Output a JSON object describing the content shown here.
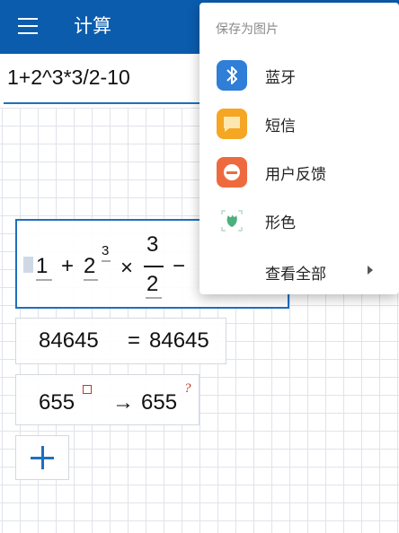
{
  "app_bar": {
    "title": "计算",
    "menu_icon": "hamburger-menu-icon",
    "color": "#0b5cad"
  },
  "input": {
    "value": "1+2^3*3/2-10"
  },
  "formula": {
    "t1": "1",
    "t2": "+",
    "t3": "2",
    "t4": "3",
    "t5": "×",
    "num": "3",
    "den": "2",
    "t6": "−"
  },
  "results": [
    {
      "lhs": "84645",
      "op": "=",
      "rhs": "84645"
    },
    {
      "lhs": "655",
      "op": "→",
      "rhs": "655",
      "mark": "?"
    }
  ],
  "add_button": {
    "icon": "plus-icon"
  },
  "share_menu": {
    "header": "保存为图片",
    "items": [
      {
        "label": "蓝牙",
        "icon": "bluetooth-icon",
        "color": "#2f7ed8"
      },
      {
        "label": "短信",
        "icon": "message-icon",
        "color": "#f5a623"
      },
      {
        "label": "用户反馈",
        "icon": "feedback-icon",
        "color": "#ee6a3e"
      },
      {
        "label": "形色",
        "icon": "xingse-plant-icon",
        "color": "#4caf7d"
      }
    ],
    "more_label": "查看全部"
  }
}
